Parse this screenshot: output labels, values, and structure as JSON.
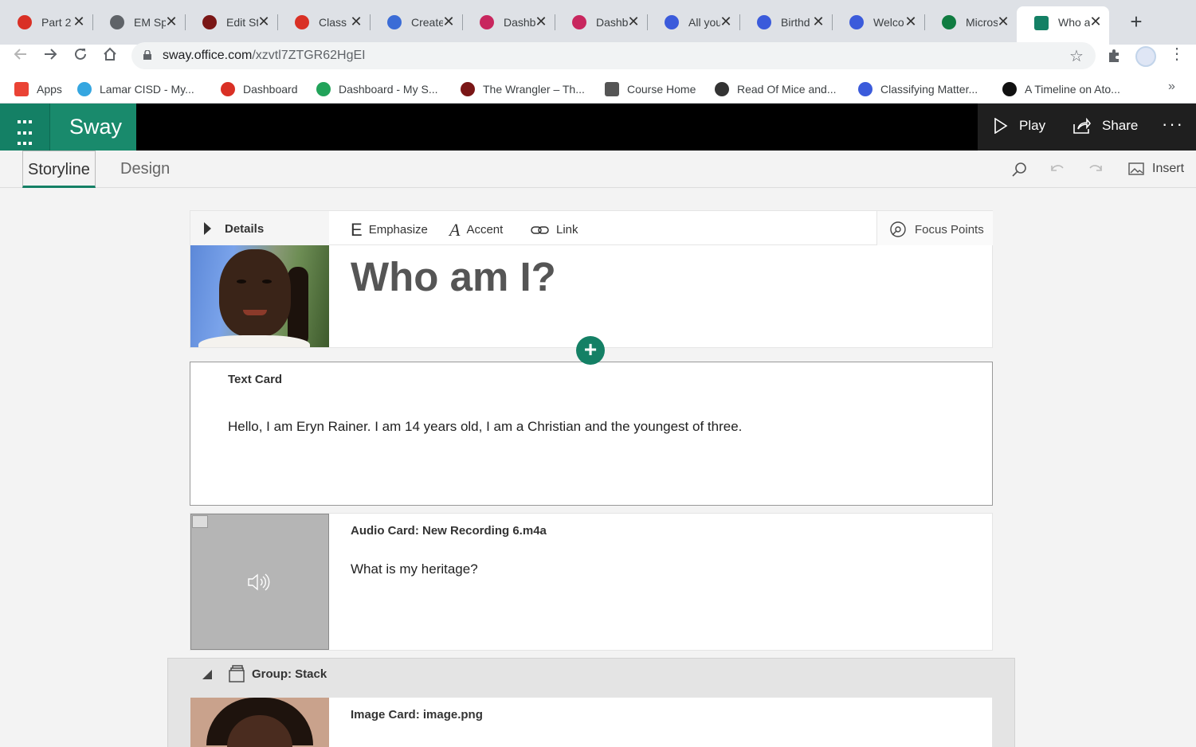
{
  "browser": {
    "tabs": [
      {
        "label": "Part 2",
        "color": "#d93025"
      },
      {
        "label": "EM Sp",
        "color": "#5f6368"
      },
      {
        "label": "Edit St",
        "color": "#7a1616"
      },
      {
        "label": "Class",
        "color": "#d93025"
      },
      {
        "label": "Create",
        "color": "#3b6cd6"
      },
      {
        "label": "Dashb",
        "color": "#c8265e"
      },
      {
        "label": "Dashb",
        "color": "#c8265e"
      },
      {
        "label": "All you",
        "color": "#3b5bdb"
      },
      {
        "label": "Birthd",
        "color": "#3b5bdb"
      },
      {
        "label": "Welco",
        "color": "#3b5bdb"
      },
      {
        "label": "Micros",
        "color": "#107c41"
      },
      {
        "label": "Who a",
        "color": "#148065"
      }
    ],
    "close_glyph": "✕",
    "new_tab_glyph": "+",
    "url_host": "sway.office.com",
    "url_path": "/xzvtl7ZTGR62HgEI",
    "bookmarks": [
      {
        "label": "Apps",
        "icon": "apps-grid-icon",
        "color": "#ea4335"
      },
      {
        "label": "Lamar CISD - My...",
        "icon": "cloud-icon",
        "color": "#35a6e0"
      },
      {
        "label": "Dashboard",
        "icon": "canvas-icon",
        "color": "#d93025"
      },
      {
        "label": "Dashboard - My S...",
        "icon": "schoology-icon",
        "color": "#22a35a"
      },
      {
        "label": "The Wrangler – Th...",
        "icon": "wrangler-icon",
        "color": "#7a1616"
      },
      {
        "label": "Course Home",
        "icon": "book-icon",
        "color": "#555"
      },
      {
        "label": "Read Of Mice and...",
        "icon": "globe-icon",
        "color": "#333"
      },
      {
        "label": "Classifying Matter...",
        "icon": "quizizz-icon",
        "color": "#3b5bdb"
      },
      {
        "label": "A Timeline on Ato...",
        "icon": "timeline-icon",
        "color": "#111"
      }
    ],
    "bookmarks_more": "»"
  },
  "sway": {
    "brand": "Sway",
    "actions": {
      "play": "Play",
      "share": "Share",
      "more": "···"
    },
    "subtabs": {
      "storyline": "Storyline",
      "design": "Design"
    },
    "insert_label": "Insert",
    "accent": "#148065"
  },
  "title_card": {
    "details_label": "Details",
    "format": {
      "emphasize": "Emphasize",
      "emphasize_glyph": "E",
      "accent": "Accent",
      "accent_glyph": "A",
      "link": "Link"
    },
    "focus_points": "Focus Points",
    "title": "Who am I?"
  },
  "add_button": "+",
  "text_card": {
    "kind": "Text Card",
    "body": "Hello, I am Eryn Rainer. I am 14 years old, I am a Christian and the youngest of three."
  },
  "audio_card": {
    "kind": "Audio Card: New Recording 6.m4a",
    "body": "What is my heritage?"
  },
  "group_card": {
    "label": "Group: Stack"
  },
  "image_card": {
    "kind": "Image Card: image.png"
  }
}
